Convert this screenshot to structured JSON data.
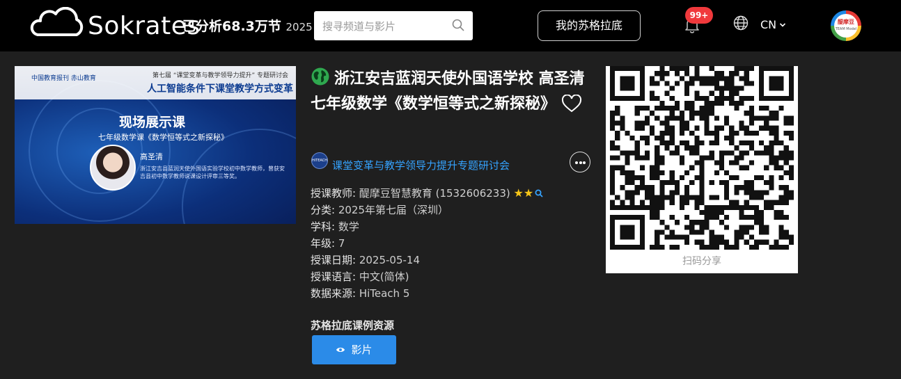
{
  "header": {
    "logo_text": "Sokrates",
    "stat_text": "已分析68.3万节",
    "stat_year": "2025",
    "search_placeholder": "搜寻频道与影片",
    "my_button": "我的苏格拉底",
    "notification_count": "99+",
    "language": "CN",
    "avatar_text": "醍摩豆",
    "avatar_subtext": "TEAM Model"
  },
  "thumbnail": {
    "logos_text": "中国教育报刊   赤山教育",
    "conference_line": "第七届 “课堂变革与教学领导力提升” 专题研讨会",
    "conference_title": "人工智能条件下课堂教学方式变革",
    "live_title": "现场展示课",
    "course_line": "七年级数学课《数学恒等式之新探秘》",
    "teacher_name": "高圣清",
    "teacher_bio": "浙江安吉县蓝润天使外国语实验学校初中数学教师，曾获安吉县初中数学教师说课设计评审三等奖。"
  },
  "lesson": {
    "title": "浙江安吉蓝润天使外国语学校 高圣清 七年级数学《数学恒等式之新探秘》",
    "channel_logo_text": "HiTEACH",
    "channel_name": "课堂变革与教学领导力提升专题研讨会",
    "meta": [
      {
        "key": "授课教师: ",
        "value": "醍摩豆智慧教育 (1532606233)"
      },
      {
        "key": "分类: ",
        "value": "2025年第七届（深圳）"
      },
      {
        "key": "学科: ",
        "value": "数学"
      },
      {
        "key": "年级: ",
        "value": "7"
      },
      {
        "key": "授课日期: ",
        "value": "2025-05-14"
      },
      {
        "key": "授课语言: ",
        "value": "中文(简体)"
      },
      {
        "key": "数据来源: ",
        "value": "HiTeach 5"
      }
    ],
    "teacher_rating_stars": 2,
    "resources_title": "苏格拉底课例资源",
    "video_button": "影片"
  },
  "qr": {
    "label": "扫码分享"
  },
  "colors": {
    "link": "#35a3ff",
    "primary_button": "#2b8be8",
    "badge": "#f0393c",
    "star": "#f5c518"
  },
  "icons": [
    "cloud-logo-icon",
    "search-icon",
    "bell-icon",
    "globe-icon",
    "chevron-down-icon",
    "earth-icon",
    "heart-icon",
    "more-icon",
    "star-icon",
    "magnifier-icon",
    "eye-icon",
    "qr-code"
  ]
}
